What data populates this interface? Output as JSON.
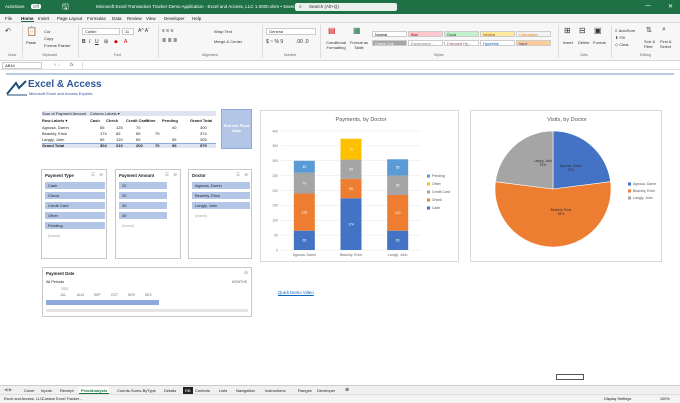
{
  "titlebar": {
    "autosave": "AutoSave",
    "autosave_state": "Off",
    "doc_title": "Microsoft Excel Transaction Tracker Demo Application - Excel and Access, LLC  1.0000.xlsm • Saved",
    "search_placeholder": "Search (Alt+Q)"
  },
  "menu": [
    "File",
    "Home",
    "Insert",
    "Page Layout",
    "Formulas",
    "Data",
    "Review",
    "View",
    "Developer",
    "Help"
  ],
  "ribbon": {
    "clipboard": {
      "paste": "Paste",
      "cut": "Cut",
      "copy": "Copy",
      "format_painter": "Format Painter",
      "group": "Clipboard"
    },
    "undo_group": "Undo",
    "font": {
      "name": "Calibri",
      "size": "11",
      "group": "Font"
    },
    "alignment": {
      "wrap": "Wrap Text",
      "merge": "Merge & Center",
      "group": "Alignment"
    },
    "number": {
      "format": "General",
      "group": "Number"
    },
    "conditional": "Conditional Formatting",
    "format_table": "Format as Table",
    "styles": [
      {
        "label": "Normal",
        "bg": "#ffffff",
        "fg": "#000000"
      },
      {
        "label": "Bad",
        "bg": "#ffc7ce",
        "fg": "#9c0006"
      },
      {
        "label": "Good",
        "bg": "#c6efce",
        "fg": "#006100"
      },
      {
        "label": "Neutral",
        "bg": "#ffeb9c",
        "fg": "#9c5700"
      },
      {
        "label": "Calculation",
        "bg": "#f2f2f2",
        "fg": "#fa7d00"
      },
      {
        "label": "Check Cell",
        "bg": "#a5a5a5",
        "fg": "#ffffff"
      },
      {
        "label": "Explanatory ...",
        "bg": "#ffffff",
        "fg": "#7f7f7f"
      },
      {
        "label": "Followed Hy...",
        "bg": "#ffffff",
        "fg": "#954f72"
      },
      {
        "label": "Hyperlink",
        "bg": "#ffffff",
        "fg": "#0563c1"
      },
      {
        "label": "Input",
        "bg": "#ffcc99",
        "fg": "#3f3f76"
      }
    ],
    "styles_group": "Styles",
    "cells": {
      "insert": "Insert",
      "delete": "Delete",
      "format": "Format",
      "group": "Cells"
    },
    "editing": {
      "autosum": "AutoSum",
      "fill": "Fill",
      "clear": "Clear",
      "sort": "Sort & Filter",
      "find": "Find & Select",
      "group": "Editing"
    }
  },
  "formula_bar": {
    "name_box": "AB44",
    "fx": "fx"
  },
  "logo": {
    "main": "Excel & Access",
    "sub": "Microsoft Excel and Access Experts"
  },
  "pivot": {
    "header_left": "Sum of Payment Amount",
    "header_right": "Column Labels",
    "row_label": "Row Labels",
    "columns": [
      "Cash",
      "Check",
      "Credit Card",
      "Other",
      "Pending",
      "Grand Total"
    ],
    "rows": [
      {
        "name": "Agnusa, Darrin",
        "vals": [
          "65",
          "125",
          "70",
          "",
          "40",
          "300"
        ]
      },
      {
        "name": "Beachly, Erick",
        "vals": [
          "174",
          "65",
          "65",
          "70",
          "",
          "374"
        ]
      },
      {
        "name": "Langly, John",
        "vals": [
          "65",
          "120",
          "65",
          "",
          "55",
          "305"
        ]
      },
      {
        "name": "Grand Total",
        "vals": [
          "304",
          "310",
          "200",
          "70",
          "95",
          "979"
        ]
      }
    ],
    "refresh_button": "Refresh Pivot Data"
  },
  "slicers": {
    "payment_type": {
      "title": "Payment Type",
      "items": [
        "Cash",
        "Check",
        "Credit Card",
        "Other",
        "Pending"
      ],
      "blank": "(blank)"
    },
    "payment_amount": {
      "title": "Payment Amount",
      "items": [
        "22",
        "25",
        "30",
        "40"
      ],
      "blank": "(blank)"
    },
    "doctor": {
      "title": "Doctor",
      "items": [
        "Agnusa, Darrin",
        "Beachly, Erick",
        "Langly, John"
      ],
      "blank": "(blank)"
    },
    "payment_date": {
      "title": "Payment Date",
      "all_periods": "All Periods",
      "level": "MONTHS",
      "year": "2022",
      "months": [
        "JUL",
        "AUG",
        "SEP",
        "OCT",
        "NOV",
        "DEC"
      ]
    }
  },
  "quick_demo_link": "Quick Demo Video",
  "chart_data": [
    {
      "type": "bar",
      "stacked": true,
      "title": "Payments, by Doctor",
      "categories": [
        "Agnusa, Darrin",
        "Beachly, Erick",
        "Langly, John"
      ],
      "series": [
        {
          "name": "Cash",
          "color": "#4472c4",
          "values": [
            65,
            174,
            65
          ]
        },
        {
          "name": "Check",
          "color": "#ed7d31",
          "values": [
            125,
            65,
            120
          ]
        },
        {
          "name": "Credit Card",
          "color": "#a5a5a5",
          "values": [
            70,
            65,
            65
          ]
        },
        {
          "name": "Other",
          "color": "#ffc000",
          "values": [
            0,
            70,
            0
          ]
        },
        {
          "name": "Pending",
          "color": "#5b9bd5",
          "values": [
            40,
            0,
            55
          ]
        }
      ],
      "ylim": [
        0,
        400
      ],
      "yticks": [
        0,
        50,
        100,
        150,
        200,
        250,
        300,
        350,
        400
      ],
      "legend": "right"
    },
    {
      "type": "pie",
      "title": "Visits, by Doctor",
      "labels": [
        "Agnusa, Darrin",
        "Beachly, Erick",
        "Langly, John"
      ],
      "values": [
        23,
        54,
        23
      ],
      "data_labels": [
        "Agnusa, Darrin\n23%",
        "Beachly, Erick\n54%",
        "Langly, John\n23%"
      ],
      "colors": [
        "#4472c4",
        "#ed7d31",
        "#a5a5a5"
      ],
      "legend": "right"
    }
  ],
  "sheet_tabs": [
    "Cover",
    "Inputs",
    "Receipt",
    "PivotAnalysis",
    "Counts-Sums-ByType",
    "Details",
    "RB",
    "Controls",
    "Lists",
    "Navigation",
    "Instructions",
    "Ranges",
    "Developer"
  ],
  "active_tab": "PivotAnalysis",
  "status": {
    "left": "Excel and Access, LLC",
    "left2": "Custom Excel Tracker...",
    "display": "Display Settings",
    "zoom": "100%"
  }
}
